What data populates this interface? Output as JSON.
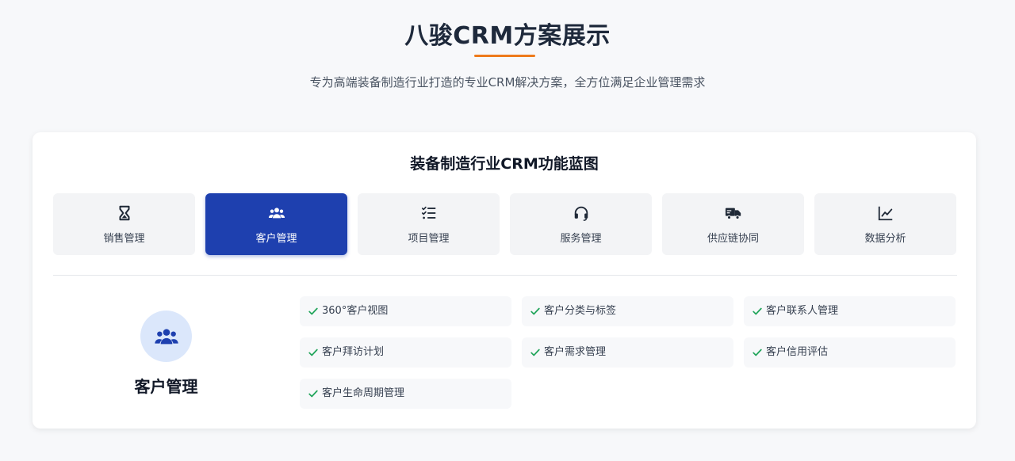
{
  "hero": {
    "title": "八骏CRM方案展示",
    "subtitle": "专为高端装备制造行业打造的专业CRM解决方案，全方位满足企业管理需求"
  },
  "section": {
    "title": "装备制造行业CRM功能蓝图",
    "tabs": [
      {
        "label": "销售管理",
        "icon": "hourglass-icon",
        "active": false
      },
      {
        "label": "客户管理",
        "icon": "users-icon",
        "active": true
      },
      {
        "label": "项目管理",
        "icon": "tasks-icon",
        "active": false
      },
      {
        "label": "服务管理",
        "icon": "headset-icon",
        "active": false
      },
      {
        "label": "供应链协同",
        "icon": "truck-icon",
        "active": false
      },
      {
        "label": "数据分析",
        "icon": "chart-line-icon",
        "active": false
      }
    ]
  },
  "feature": {
    "name": "客户管理",
    "icon": "users-icon",
    "items": [
      "360°客户视图",
      "客户分类与标签",
      "客户联系人管理",
      "客户拜访计划",
      "客户需求管理",
      "客户信用评估",
      "客户生命周期管理"
    ]
  },
  "colors": {
    "accent": "#ee7a1b",
    "primary": "#1e40af",
    "check": "#22a55b",
    "icon_bg": "#dbe7fb"
  }
}
